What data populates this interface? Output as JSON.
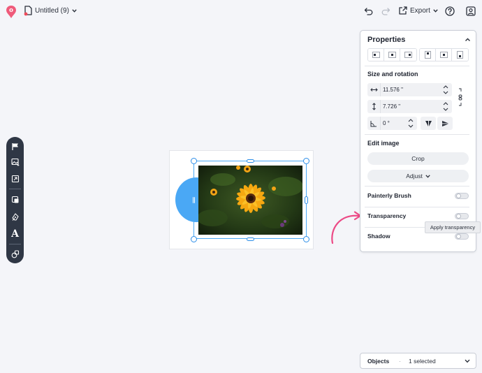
{
  "header": {
    "doc_title": "Untitled (9)",
    "export_label": "Export"
  },
  "properties": {
    "title": "Properties",
    "size_rotation_title": "Size and rotation",
    "width_value": "11.576 \"",
    "height_value": "7.726 \"",
    "rotation_value": "0 °",
    "edit_image_title": "Edit image",
    "crop_label": "Crop",
    "adjust_label": "Adjust",
    "toggles": [
      {
        "label": "Painterly Brush",
        "enabled": false
      },
      {
        "label": "Transparency",
        "enabled": false
      },
      {
        "label": "Shadow",
        "enabled": false
      }
    ]
  },
  "tooltip": {
    "text": "Apply transparency"
  },
  "objects": {
    "title": "Objects",
    "separator": "·",
    "count_label": "1 selected"
  },
  "colors": {
    "accent": "#4aa8f5",
    "toolbar_bg": "#2f3745",
    "logo": "#ef5a7a",
    "arrow": "#ec4a86"
  },
  "icons": {
    "left_toolbar": [
      "flag-icon",
      "image-sparkle-icon",
      "template-icon",
      "shapes-icon",
      "pen-icon",
      "text-icon",
      "elements-icon"
    ],
    "text_tool_glyph": "A"
  }
}
